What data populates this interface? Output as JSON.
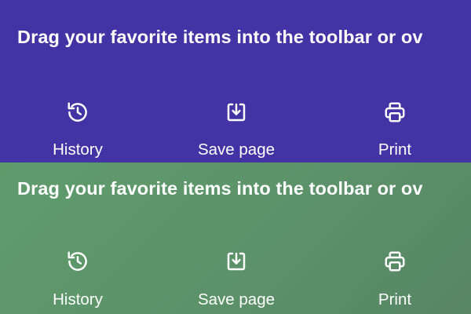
{
  "panels": [
    {
      "heading": "Drag your favorite items into the toolbar or ov",
      "background": "#4433a4",
      "tools": [
        {
          "label": "History",
          "icon": "history-icon"
        },
        {
          "label": "Save page",
          "icon": "save-page-icon"
        },
        {
          "label": "Print",
          "icon": "print-icon"
        }
      ]
    },
    {
      "heading": "Drag your favorite items into the toolbar or ov",
      "background": "#5c9269",
      "tools": [
        {
          "label": "History",
          "icon": "history-icon"
        },
        {
          "label": "Save page",
          "icon": "save-page-icon"
        },
        {
          "label": "Print",
          "icon": "print-icon"
        }
      ]
    }
  ]
}
